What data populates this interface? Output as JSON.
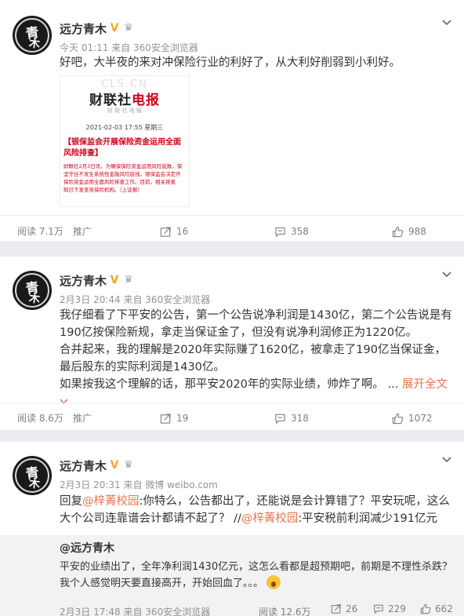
{
  "posts": [
    {
      "author": "远方青木",
      "meta": "今天 01:11 来自 360安全浏览器",
      "text": "好吧，大半夜的来对冲保险行业的利好了，从大利好削弱到小利好。",
      "image": {
        "watermark": "CLS.CN",
        "logo_prefix": "财联社",
        "logo_suffix": "电报",
        "sub": "财 联 社 电 报",
        "date": "2021-02-03 17:55 星期三",
        "headline": "【银保监会开展保险资金运用全面风险排查】",
        "body": [
          "财联社2月3日讯，为确保保险资金运用风险底数，保",
          "坚守住不发生系统性金融风险底线，银保监会决定开",
          "保险资金运用全面风险排查工作。目前，相关排查",
          "知已下发至各保险机构。（上证报）"
        ]
      },
      "actions": {
        "reads": "阅读 7.1万",
        "promote": "推广",
        "reposts": "16",
        "comments": "358",
        "likes": "988"
      }
    },
    {
      "author": "远方青木",
      "meta": "2月3日 20:44 来自 360安全浏览器",
      "paragraphs": [
        "我仔细看了下平安的公告，第一个公告说净利润是1430亿，第二个公告说是有190亿按保险新规，拿走当保证金了，但没有说净利润修正为1220亿。",
        "合并起来，我的理解是2020年实际赚了1620亿，被拿走了190亿当保证金，最后股东的实际利润是1430亿。",
        "如果按我这个理解的话，那平安2020年的实际业绩，帅炸了啊。"
      ],
      "ellipsis": "...",
      "expand": "展开全文",
      "actions": {
        "reads": "阅读 8.6万",
        "promote": "推广",
        "reposts": "19",
        "comments": "318",
        "likes": "1072"
      }
    },
    {
      "author": "远方青木",
      "meta": "2月3日 20:31 来自 微博 weibo.com",
      "reply_prefix": "回复",
      "mention1": "@梓菁校园",
      "reply_text1": ":你特么，公告都出了，还能说是会计算错了？平安玩呢，这么大个公司连靠谱会计都请不起了？ //",
      "mention2": "@梓菁校园",
      "reply_text2": ":平安税前利润减少191亿元",
      "repost": {
        "author": "@远方青木",
        "text": "平安的业绩出了，全年净利润1430亿元，这怎么看都是超预期吧，前期是不理性杀跌？我个人感觉明天要直接高开，开始回血了。。。",
        "meta": "2月3日 17:48 来自 360安全浏览器",
        "reads": "阅读 12.6万",
        "reposts": "26",
        "comments": "229",
        "likes": "662"
      }
    }
  ],
  "colors": {
    "accent": "#eb7350",
    "badge": "#f5a623",
    "background": "#eaecef"
  },
  "icons": [
    "avatar",
    "verified-v-icon",
    "crown-icon",
    "chevron-down-icon",
    "repost-icon",
    "comment-icon",
    "like-icon",
    "emoji-icon"
  ]
}
